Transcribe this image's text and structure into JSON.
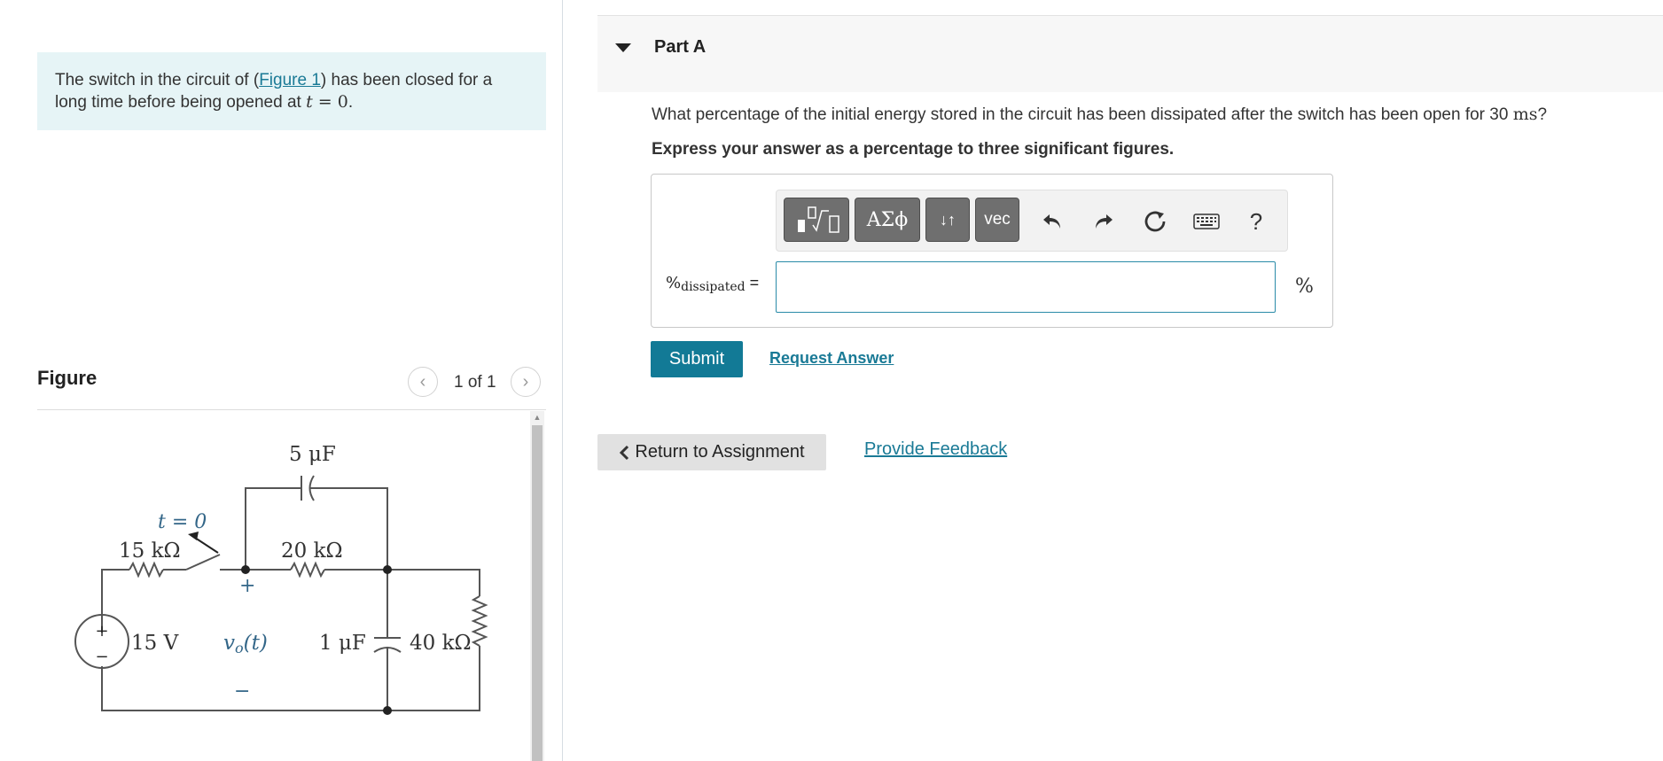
{
  "problem": {
    "text_before": "The switch in the circuit of (",
    "figure_link": "Figure 1",
    "text_middle": ") has been closed for a long time before being opened at ",
    "math_t": "t",
    "math_eq": " = 0",
    "period": "."
  },
  "figure": {
    "title": "Figure",
    "counter": "1 of 1",
    "circuit": {
      "c_top": "5 μF",
      "switch_label": "t = 0",
      "r1": "15 kΩ",
      "r2": "20 kΩ",
      "source": "15 V",
      "vo": "v",
      "vo_sub": "o",
      "vo_arg": "(t)",
      "c2": "1 μF",
      "r3": "40 kΩ",
      "plus": "+",
      "minus": "−"
    }
  },
  "part": {
    "title": "Part A",
    "question_before": "What percentage of the initial energy stored in the circuit has been dissipated after the switch has been open for 30 ",
    "question_unit": "ms",
    "question_end": "?",
    "instruction": "Express your answer as a percentage to three significant figures."
  },
  "toolbar": {
    "greek_label": "ΑΣϕ",
    "arrows_label": "↓↑",
    "vec_label": "vec",
    "help_label": "?"
  },
  "answer": {
    "label_main": "%",
    "label_sub": "dissipated",
    "equals": " =",
    "value": "",
    "unit": "%"
  },
  "actions": {
    "submit": "Submit",
    "request_answer": "Request Answer",
    "return": "Return to Assignment",
    "feedback": "Provide Feedback"
  },
  "colors": {
    "accent": "#127a96",
    "link": "#1a7a96",
    "intro_bg": "#e6f4f6",
    "circuit_ink": "#555555"
  },
  "icons": {
    "templates": "sqrt-template-icon",
    "undo": "undo-icon",
    "redo": "redo-icon",
    "reset": "reset-icon",
    "keyboard": "keyboard-icon",
    "collapse": "caret-down-icon"
  }
}
